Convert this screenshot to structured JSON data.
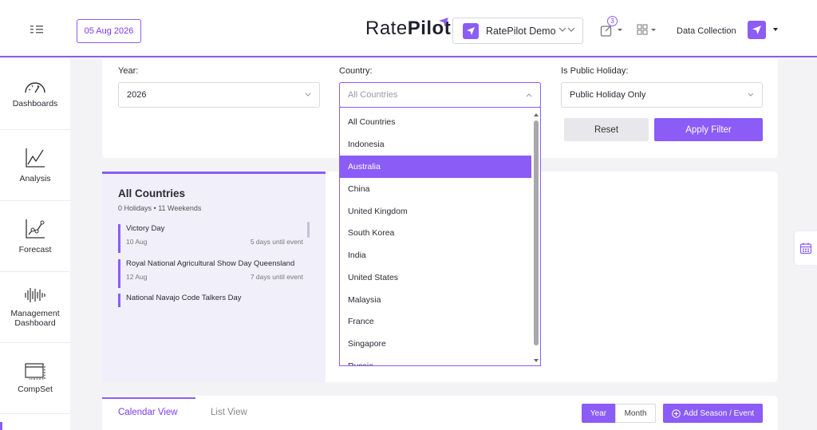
{
  "header": {
    "date": "05 Aug 2026",
    "logo_rate": "Rate",
    "logo_pilot": "Pilot",
    "property": "RatePilot Demo",
    "share_count": "3",
    "data_collection": "Data Collection"
  },
  "sidebar": {
    "items": [
      {
        "label": "Dashboards",
        "icon": "gauge-icon"
      },
      {
        "label": "Analysis",
        "icon": "line-chart-icon"
      },
      {
        "label": "Forecast",
        "icon": "forecast-chart-icon"
      },
      {
        "label": "Management Dashboard",
        "icon": "bars-icon"
      },
      {
        "label": "CompSet",
        "icon": "window-icon"
      }
    ]
  },
  "filters": {
    "year_label": "Year:",
    "year_value": "2026",
    "country_label": "Country:",
    "country_placeholder": "All Countries",
    "holiday_label": "Is Public Holiday:",
    "holiday_value": "Public Holiday Only",
    "reset": "Reset",
    "apply": "Apply Filter"
  },
  "country_dropdown": {
    "options": [
      "All Countries",
      "Indonesia",
      "Australia",
      "China",
      "United Kingdom",
      "South Korea",
      "India",
      "United States",
      "Malaysia",
      "France",
      "Singapore",
      "Russia"
    ],
    "highlighted": "Australia"
  },
  "events": {
    "title": "All Countries",
    "holidays": "0 Holidays",
    "weekends": "11 Weekends",
    "items": [
      {
        "name": "Victory Day",
        "date": "10 Aug",
        "until": "5 days until event"
      },
      {
        "name": "Royal National Agricultural Show Day Queensland",
        "date": "12 Aug",
        "until": "7 days until event"
      },
      {
        "name": "National Navajo Code Talkers Day",
        "date": "",
        "until": ""
      }
    ]
  },
  "bottom": {
    "tab_calendar": "Calendar View",
    "tab_list": "List View",
    "seg_year": "Year",
    "seg_month": "Month",
    "add": "Add Season / Event"
  },
  "colors": {
    "accent": "#8b5cf6"
  }
}
